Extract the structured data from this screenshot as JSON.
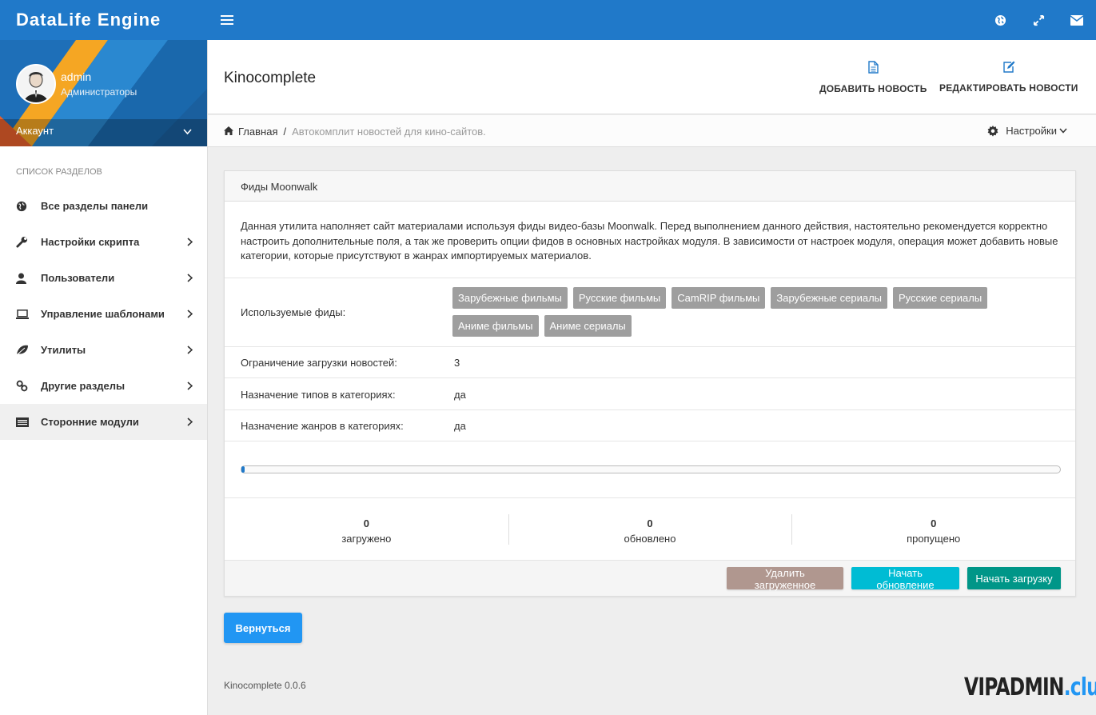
{
  "brand": "DataLife Engine",
  "user": {
    "name": "admin",
    "role": "Администраторы",
    "account_label": "Аккаунт"
  },
  "sidebar": {
    "header": "СПИСОК РАЗДЕЛОВ",
    "items": [
      {
        "label": "Все разделы панели",
        "icon": "globe-icon"
      },
      {
        "label": "Настройки скрипта",
        "icon": "wrench-icon"
      },
      {
        "label": "Пользователи",
        "icon": "user-icon"
      },
      {
        "label": "Управление шаблонами",
        "icon": "laptop-icon"
      },
      {
        "label": "Утилиты",
        "icon": "leaf-icon"
      },
      {
        "label": "Другие разделы",
        "icon": "link-icon"
      },
      {
        "label": "Сторонние модули",
        "icon": "list-icon"
      }
    ]
  },
  "header": {
    "title": "Kinocomplete",
    "add_news": "ДОБАВИТЬ НОВОСТЬ",
    "edit_news": "РЕДАКТИРОВАТЬ НОВОСТИ"
  },
  "breadcrumb": {
    "home": "Главная",
    "separator": "/",
    "current": "Автокомплит новостей для кино-сайтов."
  },
  "settings_label": "Настройки",
  "panel": {
    "heading": "Фиды Moonwalk",
    "description": "Данная утилита наполняет сайт материалами используя фиды видео-базы Moonwalk. Перед выполнением данного действия, настоятельно рекомендуется корректно настроить дополнительные поля, а так же проверить опции фидов в основных настройках модуля. В зависимости от настроек модуля, операция может добавить новые категории, которые присутствуют в жанрах импортируемых материалов.",
    "feeds_label": "Используемые фиды:",
    "feeds": [
      "Зарубежные фильмы",
      "Русские фильмы",
      "CamRIP фильмы",
      "Зарубежные сериалы",
      "Русские сериалы",
      "Аниме фильмы",
      "Аниме сериалы"
    ],
    "limit_label": "Ограничение загрузки новостей:",
    "limit_value": "3",
    "types_label": "Назначение типов в категориях:",
    "types_value": "да",
    "genres_label": "Назначение жанров в категориях:",
    "genres_value": "да",
    "progress": 0.004,
    "stats": [
      {
        "value": "0",
        "label": "загружено"
      },
      {
        "value": "0",
        "label": "обновлено"
      },
      {
        "value": "0",
        "label": "пропущено"
      }
    ],
    "buttons": {
      "delete": "Удалить загруженное",
      "update": "Начать обновление",
      "load": "Начать загрузку"
    }
  },
  "back_button": "Вернуться",
  "footer_version": "Kinocomplete 0.0.6",
  "watermark": {
    "main": "VIPADMIN",
    "suffix": ".club"
  },
  "colors": {
    "navbar": "#2079c9",
    "tag": "#9e9e9e",
    "delete_btn": "#b0978f",
    "update_btn": "#00bcd4",
    "load_btn": "#009688",
    "back_btn": "#2196f3"
  }
}
